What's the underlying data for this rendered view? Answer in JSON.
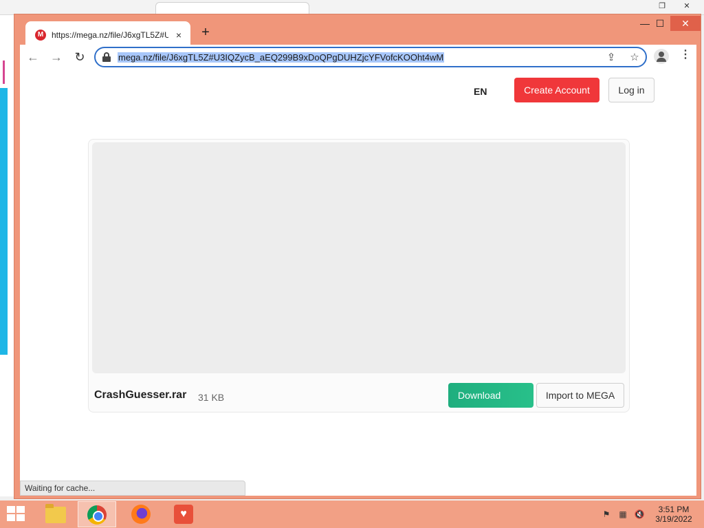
{
  "browser": {
    "tab": {
      "title": "https://mega.nz/file/J6xgTL5Z#U",
      "favicon_letter": "M",
      "close_glyph": "×"
    },
    "new_tab_glyph": "+",
    "window_controls": {
      "minimize": "—",
      "maximize": "☐",
      "close": "✕"
    },
    "toolbar": {
      "back_glyph": "←",
      "forward_glyph": "→",
      "reload_glyph": "↻",
      "url": "mega.nz/file/J6xgTL5Z#U3IQZycB_aEQ299B9xDoQPgDUHZjcYFVofcKOOht4wM",
      "share_glyph": "⇪",
      "bookmark_glyph": "☆",
      "menu_glyph": "⋮"
    },
    "status": "Waiting for cache..."
  },
  "page": {
    "language": "EN",
    "create_account_label": "Create Account",
    "login_label": "Log in",
    "file": {
      "name": "CrashGuesser.rar",
      "size": "31 KB"
    },
    "download_label": "Download",
    "import_label": "Import to MEGA"
  },
  "taskbar": {
    "apps": [
      "file-explorer",
      "chrome",
      "firefox",
      "health-monitor"
    ],
    "clock": {
      "time": "3:51 PM",
      "date": "3/19/2022"
    }
  },
  "colors": {
    "frame": "#f0967a",
    "accent_red": "#f0373a",
    "download_green": "#1fae7e",
    "url_selection": "#a8c7fa"
  }
}
